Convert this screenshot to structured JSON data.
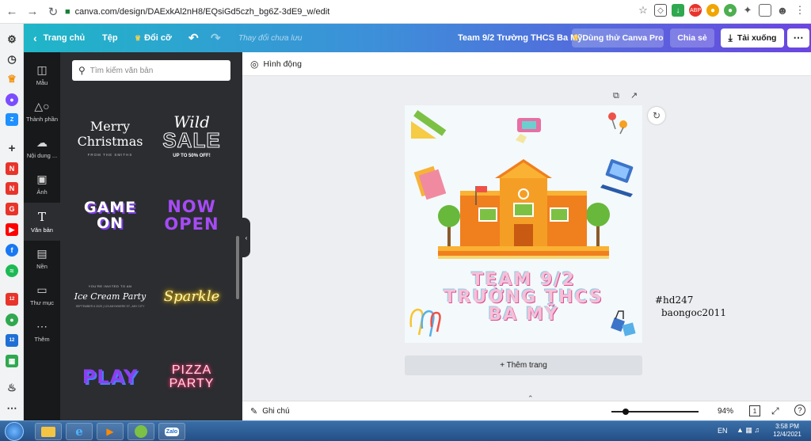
{
  "browser": {
    "url": "canva.com/design/DAExkAl2nH8/EQsiGd5czh_bg6Z-3dE9_w/edit"
  },
  "header": {
    "home_label": "Trang chủ",
    "file_label": "Tệp",
    "resize_label": "Đổi cỡ",
    "save_status": "Thay đổi chưa lưu",
    "doc_title": "Team 9/2 Trường THCS Ba Mỹ",
    "pro_label": "Dùng thử Canva Pro",
    "share_label": "Chia sẻ",
    "download_label": "Tải xuống"
  },
  "rail": {
    "items": [
      {
        "label": "Mẫu",
        "icon": "layout-icon"
      },
      {
        "label": "Thành phần",
        "icon": "shapes-icon"
      },
      {
        "label": "Nội dung ...",
        "icon": "upload-icon"
      },
      {
        "label": "Ảnh",
        "icon": "image-icon"
      },
      {
        "label": "Văn bản",
        "icon": "text-icon"
      },
      {
        "label": "Nền",
        "icon": "background-icon"
      },
      {
        "label": "Thư mục",
        "icon": "folder-icon"
      },
      {
        "label": "Thêm",
        "icon": "more-icon"
      }
    ]
  },
  "panel": {
    "search_placeholder": "Tìm kiếm văn bản",
    "cards": [
      {
        "line1": "Merry",
        "line2": "Christmas",
        "line3": "FROM THE SMITHS"
      },
      {
        "line1": "Wild",
        "line2": "SALE",
        "line3": "UP TO 50% OFF!"
      },
      {
        "line1": "GAME",
        "line2": "ON"
      },
      {
        "line1": "NOW",
        "line2": "OPEN"
      },
      {
        "line1": "YOU'RE INVITED TO AN",
        "line2": "Ice Cream Party",
        "line3": "SEPTEMBER 6 2025 | 123 ANYWHERE ST., ANY CITY"
      },
      {
        "line1": "Sparkle"
      },
      {
        "line1": "PLAY"
      },
      {
        "line1": "PIZZA",
        "line2": "PARTY"
      }
    ]
  },
  "workspace": {
    "animate_label": "Hình động",
    "design_lines": [
      "TEAM 9/2",
      "TRƯỜNG THCS",
      "BA MỸ"
    ],
    "side_note_1": "#hd247",
    "side_note_2": "baongoc2011",
    "add_page_label": "+ Thêm trang",
    "notes_label": "Ghi chú",
    "zoom": "94%",
    "page_count": "1"
  },
  "taskbar": {
    "language": "EN",
    "time": "3:58 PM",
    "date": "12/4/2021"
  },
  "colors": {
    "header_start": "#1fb6c8",
    "header_end": "#6b45e0",
    "panel": "#2b2d31",
    "rail": "#18191b",
    "title_pink": "#ee86b8",
    "school_orange": "#f07f1e"
  }
}
